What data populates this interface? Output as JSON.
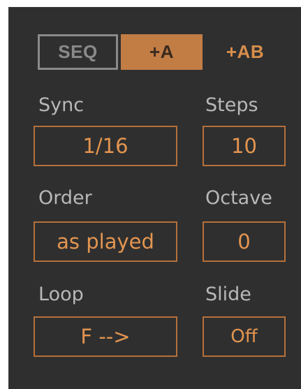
{
  "mode_tabs": {
    "seq": "SEQ",
    "a": "+A",
    "ab": "+AB",
    "active": "+A"
  },
  "sync": {
    "label": "Sync",
    "value": "1/16"
  },
  "steps": {
    "label": "Steps",
    "value": "10"
  },
  "order": {
    "label": "Order",
    "value": "as played"
  },
  "octave": {
    "label": "Octave",
    "value": "0"
  },
  "loop": {
    "label": "Loop",
    "value": "F -->"
  },
  "slide": {
    "label": "Slide",
    "value": "Off"
  },
  "colors": {
    "panel": "#2f2f2f",
    "accent": "#c27d45",
    "accent_text": "#e39550",
    "label_text": "#b8b8b8",
    "inactive_border": "#8a8a8a"
  }
}
